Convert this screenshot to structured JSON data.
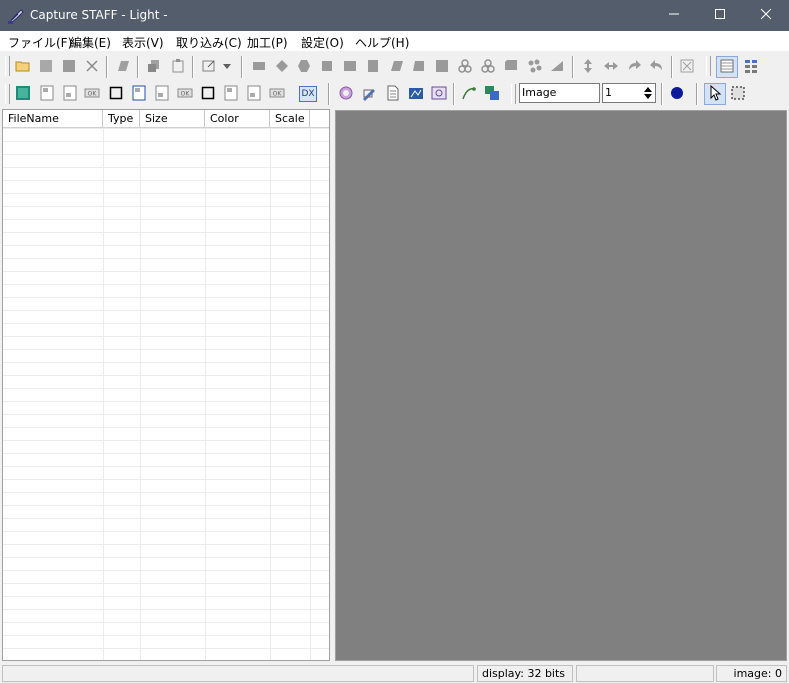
{
  "window": {
    "title": "Capture STAFF - Light -",
    "app_icon": "feather-pen-icon",
    "controls": {
      "minimize": "minimize-icon",
      "maximize": "maximize-icon",
      "close": "close-icon"
    }
  },
  "menu": [
    "ファイル(F)",
    "編集(E)",
    "表示(V)",
    "取り込み(C)",
    "加工(P)",
    "設定(O)",
    "ヘルプ(H)"
  ],
  "toolbar1": {
    "icons": [
      "open-folder-icon",
      "save-icon",
      "save-all-icon",
      "delete-icon",
      "print-icon",
      "copy-icon",
      "paste-icon",
      "edit-icon",
      "dropdown-icon",
      "rect-capture-icon",
      "circle-capture-icon",
      "hexagon-capture-icon",
      "window-capture-icon",
      "client-capture-icon",
      "menu-capture-icon",
      "parallelogram-icon",
      "trapezoid-icon",
      "full-screen-icon",
      "ring-icon",
      "ring-outline-icon",
      "stack-icon",
      "scatter-icon",
      "triangle-icon",
      "flip-vertical-icon",
      "flip-horizontal-icon",
      "rotate-left-icon",
      "rotate-right-icon",
      "fit-icon",
      "list-view-icon",
      "detail-view-icon"
    ]
  },
  "toolbar2": {
    "combo_type": "Image",
    "spinner_value": "1",
    "dx_label": "DX",
    "icons": [
      "color-icon",
      "frame-a-icon",
      "frame-b-icon",
      "ok-frame-a-icon",
      "border-a-icon",
      "frame-c-icon",
      "frame-d-icon",
      "ok-frame-b-icon",
      "border-b-icon",
      "frame-e-icon",
      "frame-f-icon",
      "ok-frame-c-icon",
      "dx-icon",
      "settings-gear-icon",
      "pen-tool-icon",
      "document-icon",
      "image-edit-icon",
      "image-frame-icon",
      "curve-icon",
      "layers-icon",
      "circle-fill-icon",
      "pointer-icon",
      "marquee-select-icon"
    ]
  },
  "file_list": {
    "columns": [
      "FileName",
      "Type",
      "Size",
      "Color",
      "Scale"
    ],
    "rows": []
  },
  "status": {
    "left": "",
    "display": "display: 32 bits",
    "middle": "",
    "image": "image: 0"
  },
  "colors": {
    "titlebar": "#535d6b",
    "preview_bg": "#808080",
    "active_toolbar_btn": "#d4e2f6"
  }
}
